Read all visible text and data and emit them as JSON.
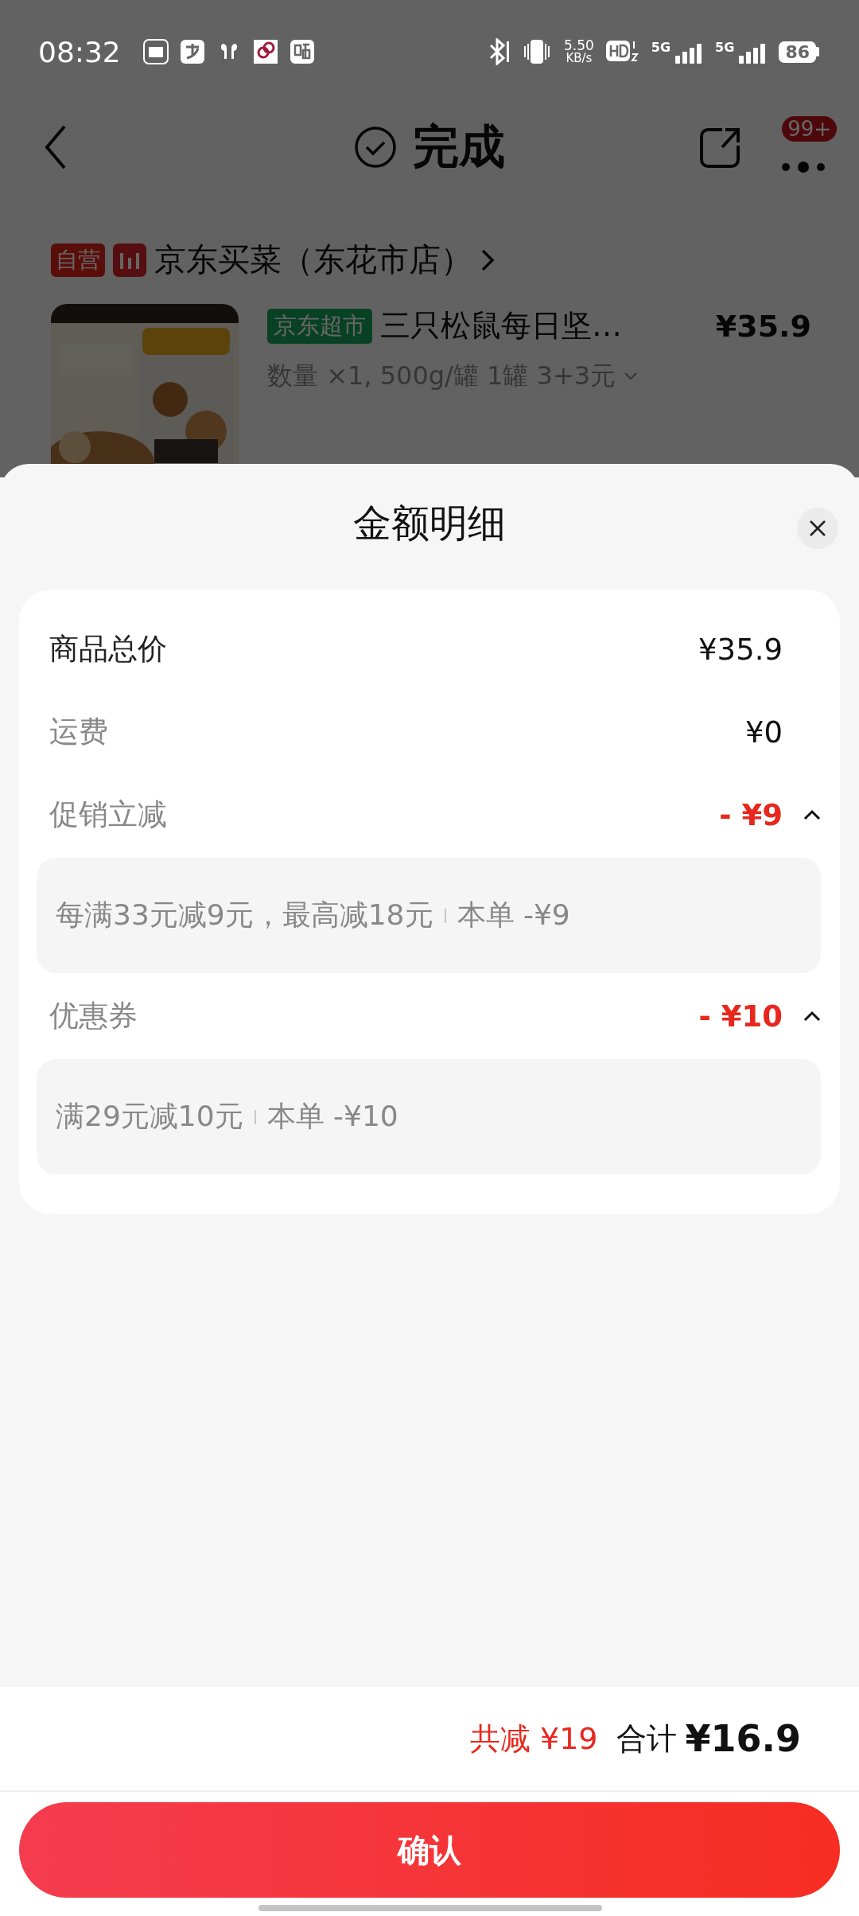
{
  "status_bar": {
    "time": "08:32",
    "speed_value": "5.50",
    "speed_unit": "KB/s",
    "sim_labels": [
      "5G",
      "5G"
    ],
    "battery": "86"
  },
  "header": {
    "title": "完成",
    "badge": "99+"
  },
  "store": {
    "tag": "自营",
    "name": "京东买菜（东花市店）",
    "product": {
      "tag": "京东超市",
      "name": "三只松鼠每日坚…",
      "spec": "数量 ×1, 500g/罐 1罐 3+3元",
      "price": "¥35.9"
    }
  },
  "sheet": {
    "title": "金额明细",
    "rows": [
      {
        "kind": "total",
        "label": "商品总价",
        "value": "¥35.9"
      },
      {
        "kind": "fee",
        "label": "运费",
        "value": "¥0"
      },
      {
        "kind": "discount",
        "label": "促销立减",
        "value": "- ¥9",
        "expanded": true,
        "detail": {
          "rule": "每满33元减9元，最高减18元",
          "current": "本单 -¥9"
        }
      },
      {
        "kind": "discount",
        "label": "优惠券",
        "value": "- ¥10",
        "expanded": true,
        "detail": {
          "rule": "满29元减10元",
          "current": "本单 -¥10"
        }
      }
    ]
  },
  "footer": {
    "saved": "共减 ¥19",
    "total_label": "合计",
    "total": "¥16.9",
    "button": "确认"
  }
}
